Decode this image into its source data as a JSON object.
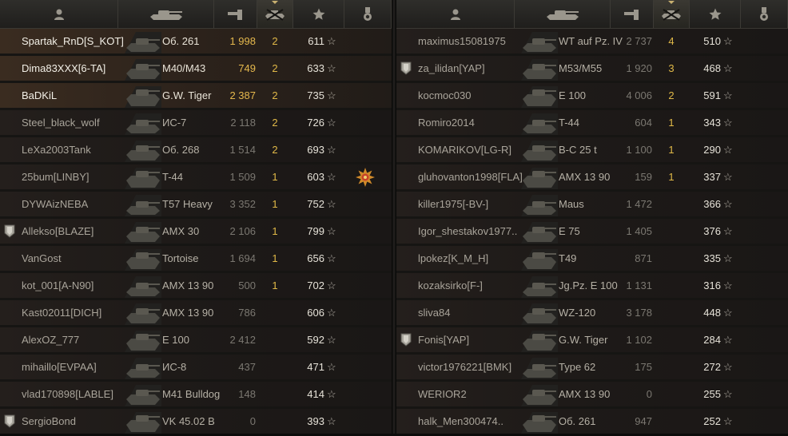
{
  "colors": {
    "gold": "#e5b84d",
    "white": "#f2efe6",
    "dim": "#8f8c85",
    "row_bg": "#1e1a18"
  },
  "header_icons": [
    "player-icon",
    "tank-icon",
    "damage-icon",
    "frags-icon",
    "experience-star-icon",
    "achievement-icon"
  ],
  "left_team": {
    "rows": [
      {
        "player": "Spartak_RnD[S_KOT]",
        "tank": "Об. 261",
        "damage": "1 998",
        "frags": "2",
        "xp": "611",
        "badge": false,
        "medal": false,
        "bright": true,
        "gold_damage": true,
        "hl": true
      },
      {
        "player": "Dima83XXX[6-TA]",
        "tank": "M40/M43",
        "damage": "749",
        "frags": "2",
        "xp": "633",
        "badge": false,
        "medal": false,
        "bright": true,
        "gold_damage": true,
        "hl": true
      },
      {
        "player": "BaDKiL",
        "tank": "G.W. Tiger",
        "damage": "2 387",
        "frags": "2",
        "xp": "735",
        "badge": false,
        "medal": false,
        "bright": true,
        "gold_damage": true,
        "hl": true
      },
      {
        "player": "Steel_black_wolf",
        "tank": "ИС-7",
        "damage": "2 118",
        "frags": "2",
        "xp": "726",
        "badge": false,
        "medal": false
      },
      {
        "player": "LeXa2003Tank",
        "tank": "Об. 268",
        "damage": "1 514",
        "frags": "2",
        "xp": "693",
        "badge": false,
        "medal": false
      },
      {
        "player": "25bum[LINBY]",
        "tank": "T-44",
        "damage": "1 509",
        "frags": "1",
        "xp": "603",
        "badge": false,
        "medal": true
      },
      {
        "player": "DYWAizNEBA",
        "tank": "T57 Heavy",
        "damage": "3 352",
        "frags": "1",
        "xp": "752",
        "badge": false,
        "medal": false
      },
      {
        "player": "Allekso[BLAZE]",
        "tank": "AMX 30",
        "damage": "2 106",
        "frags": "1",
        "xp": "799",
        "badge": true,
        "medal": false
      },
      {
        "player": "VanGost",
        "tank": "Tortoise",
        "damage": "1 694",
        "frags": "1",
        "xp": "656",
        "badge": false,
        "medal": false
      },
      {
        "player": "kot_001[A-N90]",
        "tank": "AMX 13 90",
        "damage": "500",
        "frags": "1",
        "xp": "702",
        "badge": false,
        "medal": false
      },
      {
        "player": "Kast02011[DICH]",
        "tank": "AMX 13 90",
        "damage": "786",
        "frags": "",
        "xp": "606",
        "badge": false,
        "medal": false
      },
      {
        "player": "AlexOZ_777",
        "tank": "E 100",
        "damage": "2 412",
        "frags": "",
        "xp": "592",
        "badge": false,
        "medal": false
      },
      {
        "player": "mihaillo[EVPAA]",
        "tank": "ИС-8",
        "damage": "437",
        "frags": "",
        "xp": "471",
        "badge": false,
        "medal": false
      },
      {
        "player": "vlad170898[LABLE]",
        "tank": "M41 Bulldog",
        "damage": "148",
        "frags": "",
        "xp": "414",
        "badge": false,
        "medal": false
      },
      {
        "player": "SergioBond",
        "tank": "VK 45.02 B",
        "damage": "0",
        "frags": "",
        "xp": "393",
        "badge": true,
        "medal": false
      }
    ]
  },
  "right_team": {
    "rows": [
      {
        "player": "maximus15081975",
        "tank": "WT auf Pz. IV",
        "damage": "2 737",
        "frags": "4",
        "xp": "510",
        "badge": false,
        "medal": false
      },
      {
        "player": "za_ilidan[YAP]",
        "tank": "M53/M55",
        "damage": "1 920",
        "frags": "3",
        "xp": "468",
        "badge": true,
        "medal": false
      },
      {
        "player": "kocmoc030",
        "tank": "E 100",
        "damage": "4 006",
        "frags": "2",
        "xp": "591",
        "badge": false,
        "medal": false
      },
      {
        "player": "Romiro2014",
        "tank": "T-44",
        "damage": "604",
        "frags": "1",
        "xp": "343",
        "badge": false,
        "medal": false
      },
      {
        "player": "KOMARIKOV[LG-R]",
        "tank": "B-C 25 t",
        "damage": "1 100",
        "frags": "1",
        "xp": "290",
        "badge": false,
        "medal": false
      },
      {
        "player": "gluhovanton1998[FLA]",
        "tank": "AMX 13 90",
        "damage": "159",
        "frags": "1",
        "xp": "337",
        "badge": false,
        "medal": false
      },
      {
        "player": "killer1975[-BV-]",
        "tank": "Maus",
        "damage": "1 472",
        "frags": "",
        "xp": "366",
        "badge": false,
        "medal": false
      },
      {
        "player": "Igor_shestakov1977..",
        "tank": "E 75",
        "damage": "1 405",
        "frags": "",
        "xp": "376",
        "badge": false,
        "medal": false
      },
      {
        "player": "lpokez[K_M_H]",
        "tank": "T49",
        "damage": "871",
        "frags": "",
        "xp": "335",
        "badge": false,
        "medal": false
      },
      {
        "player": "kozaksirko[F-]",
        "tank": "Jg.Pz. E 100",
        "damage": "1 131",
        "frags": "",
        "xp": "316",
        "badge": false,
        "medal": false
      },
      {
        "player": "sliva84",
        "tank": "WZ-120",
        "damage": "3 178",
        "frags": "",
        "xp": "448",
        "badge": false,
        "medal": false
      },
      {
        "player": "Fonis[YAP]",
        "tank": "G.W. Tiger",
        "damage": "1 102",
        "frags": "",
        "xp": "284",
        "badge": true,
        "medal": false
      },
      {
        "player": "victor1976221[BMK]",
        "tank": "Type 62",
        "damage": "175",
        "frags": "",
        "xp": "272",
        "badge": false,
        "medal": false
      },
      {
        "player": "WERIOR2",
        "tank": "AMX 13 90",
        "damage": "0",
        "frags": "",
        "xp": "255",
        "badge": false,
        "medal": false
      },
      {
        "player": "halk_Men300474..",
        "tank": "Об. 261",
        "damage": "947",
        "frags": "",
        "xp": "252",
        "badge": false,
        "medal": false
      }
    ]
  }
}
